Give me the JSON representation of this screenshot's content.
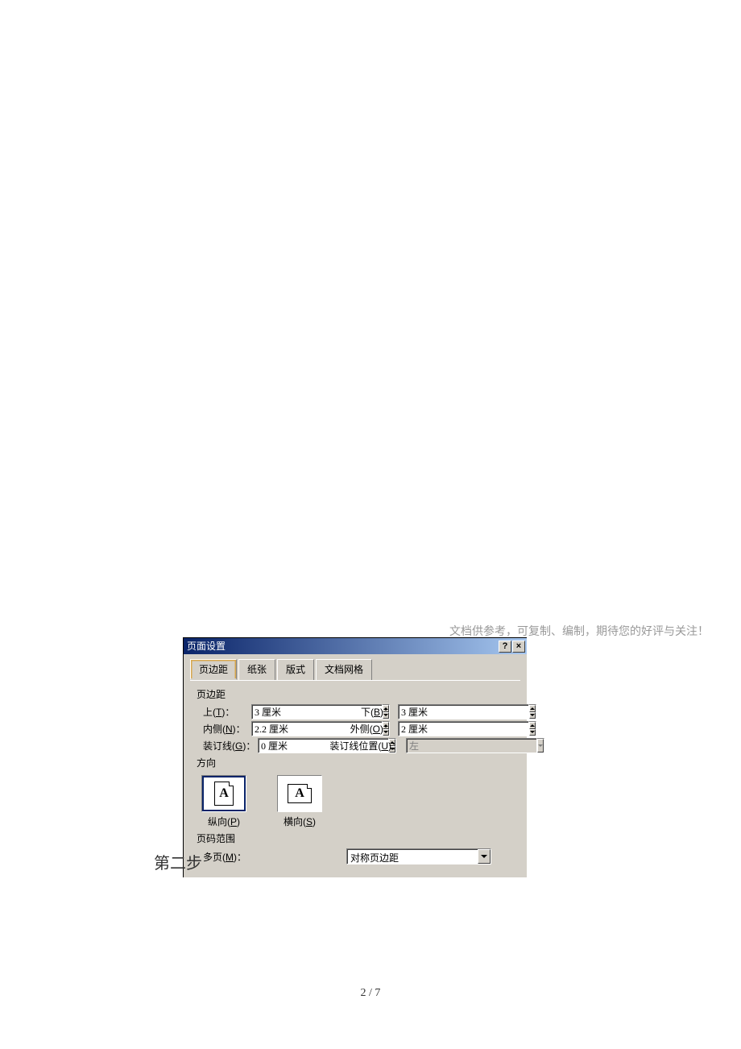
{
  "doc_note": "文档供参考，可复制、编制，期待您的好评与关注！",
  "dialog": {
    "title": "页面设置",
    "tabs": [
      "页边距",
      "纸张",
      "版式",
      "文档网格"
    ],
    "margins": {
      "section_label": "页边距",
      "top_label": "上(T)：",
      "top_value": "3 厘米",
      "bottom_label": "下(B)：",
      "bottom_value": "3 厘米",
      "inside_label": "内侧(N)：",
      "inside_value": "2.2 厘米",
      "outside_label": "外侧(O)：",
      "outside_value": "2 厘米",
      "gutter_label": "装订线(G)：",
      "gutter_value": "0 厘米",
      "gutter_pos_label": "装订线位置(U)：",
      "gutter_pos_value": "左"
    },
    "orientation": {
      "section_label": "方向",
      "portrait_label": "纵向(P)",
      "landscape_label": "横向(S)"
    },
    "page_range": {
      "section_label": "页码范围",
      "multi_label": "多页(M)：",
      "multi_value": "对称页边距"
    }
  },
  "step_text": "第二步",
  "page_num": "2 / 7"
}
